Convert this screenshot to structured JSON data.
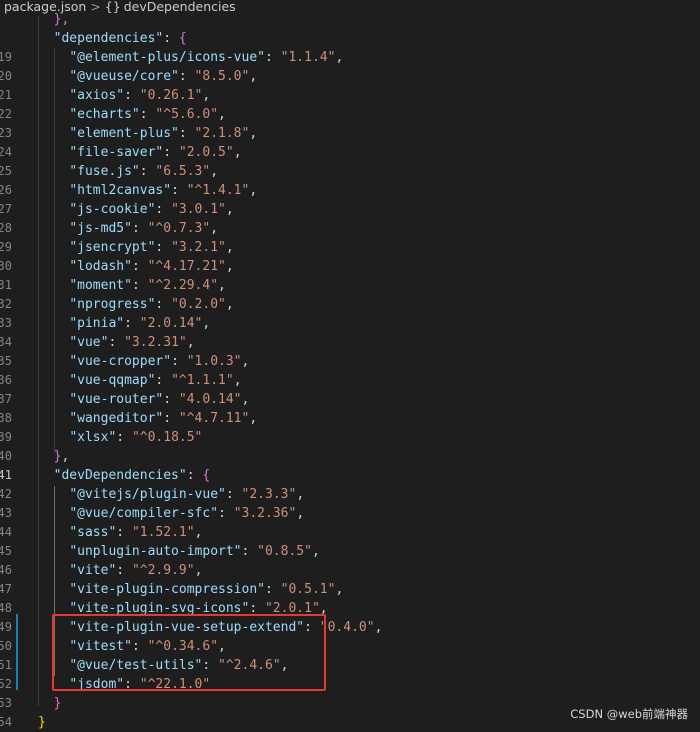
{
  "breadcrumb": {
    "file": "package.json",
    "separator": ">",
    "symbol_braces": "{}",
    "section": "devDependencies"
  },
  "top_partial": "},",
  "dependencies_key": "\"dependencies\"",
  "dependencies": [
    {
      "ln": "19",
      "name": "@element-plus/icons-vue",
      "version": "1.1.4"
    },
    {
      "ln": "20",
      "name": "@vueuse/core",
      "version": "8.5.0"
    },
    {
      "ln": "21",
      "name": "axios",
      "version": "0.26.1"
    },
    {
      "ln": "22",
      "name": "echarts",
      "version": "^5.6.0"
    },
    {
      "ln": "23",
      "name": "element-plus",
      "version": "2.1.8"
    },
    {
      "ln": "24",
      "name": "file-saver",
      "version": "2.0.5"
    },
    {
      "ln": "25",
      "name": "fuse.js",
      "version": "6.5.3"
    },
    {
      "ln": "26",
      "name": "html2canvas",
      "version": "^1.4.1"
    },
    {
      "ln": "27",
      "name": "js-cookie",
      "version": "3.0.1"
    },
    {
      "ln": "28",
      "name": "js-md5",
      "version": "^0.7.3"
    },
    {
      "ln": "29",
      "name": "jsencrypt",
      "version": "3.2.1"
    },
    {
      "ln": "30",
      "name": "lodash",
      "version": "^4.17.21"
    },
    {
      "ln": "31",
      "name": "moment",
      "version": "^2.29.4"
    },
    {
      "ln": "32",
      "name": "nprogress",
      "version": "0.2.0"
    },
    {
      "ln": "33",
      "name": "pinia",
      "version": "2.0.14"
    },
    {
      "ln": "34",
      "name": "vue",
      "version": "3.2.31"
    },
    {
      "ln": "35",
      "name": "vue-cropper",
      "version": "1.0.3"
    },
    {
      "ln": "36",
      "name": "vue-qqmap",
      "version": "^1.1.1"
    },
    {
      "ln": "37",
      "name": "vue-router",
      "version": "4.0.14"
    },
    {
      "ln": "38",
      "name": "wangeditor",
      "version": "^4.7.11"
    },
    {
      "ln": "39",
      "name": "xlsx",
      "version": "^0.18.5"
    }
  ],
  "closing_ln": "40",
  "dev_key_ln": "41",
  "devDependencies_key": "\"devDependencies\"",
  "devDependencies": [
    {
      "ln": "42",
      "name": "@vitejs/plugin-vue",
      "version": "2.3.3"
    },
    {
      "ln": "43",
      "name": "@vue/compiler-sfc",
      "version": "3.2.36"
    },
    {
      "ln": "44",
      "name": "sass",
      "version": "1.52.1"
    },
    {
      "ln": "45",
      "name": "unplugin-auto-import",
      "version": "0.8.5"
    },
    {
      "ln": "46",
      "name": "vite",
      "version": "^2.9.9"
    },
    {
      "ln": "47",
      "name": "vite-plugin-compression",
      "version": "0.5.1"
    },
    {
      "ln": "48",
      "name": "vite-plugin-svg-icons",
      "version": "2.0.1"
    },
    {
      "ln": "49",
      "name": "vite-plugin-vue-setup-extend",
      "version": "0.4.0"
    },
    {
      "ln": "50",
      "name": "vitest",
      "version": "^0.34.6"
    },
    {
      "ln": "51",
      "name": "@vue/test-utils",
      "version": "^2.4.6"
    },
    {
      "ln": "52",
      "name": "jsdom",
      "version": "^22.1.0"
    }
  ],
  "dev_close_ln": "53",
  "root_close_ln": "54",
  "watermark": "CSDN @web前端神器",
  "colors": {
    "background": "#1e1e1e",
    "key": "#9cdcfe",
    "string": "#ce9178",
    "highlight_box": "#e53935",
    "modified_bar": "#1b81a8"
  }
}
